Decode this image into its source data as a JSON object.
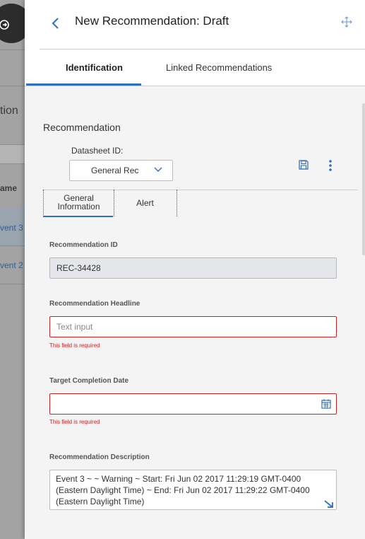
{
  "background": {
    "partial_heading": "tion",
    "column_header": "ame",
    "rows": [
      "vent 3",
      "vent 2"
    ]
  },
  "panel": {
    "title": "New Recommendation: Draft",
    "tabs": [
      {
        "label": "Identification",
        "active": true
      },
      {
        "label": "Linked Recommendations",
        "active": false
      }
    ],
    "section_title": "Recommendation",
    "datasheet": {
      "label": "Datasheet ID:",
      "value": "General Rec"
    },
    "subtabs": [
      {
        "label": "General Information",
        "active": true
      },
      {
        "label": "Alert",
        "active": false
      }
    ],
    "fields": {
      "rec_id": {
        "label": "Recommendation ID",
        "value": "REC-34428"
      },
      "headline": {
        "label": "Recommendation Headline",
        "placeholder": "Text input",
        "error": "This field is required"
      },
      "target_date": {
        "label": "Target Completion Date",
        "value": "",
        "error": "This field is required"
      },
      "description": {
        "label": "Recommendation Description",
        "value": "Event 3 ~ ~ Warning ~ Start: Fri Jun 02 2017 11:29:19 GMT-0400 (Eastern Daylight Time) ~ End: Fri Jun 02 2017 11:29:22 GMT-0400 (Eastern Daylight Time)"
      }
    }
  },
  "icons": {
    "back": "chevron-left-icon",
    "expand": "move-icon",
    "save": "save-icon",
    "more": "kebab-icon",
    "calendar": "calendar-icon",
    "resize": "resize-handle-icon",
    "sidebar_toggle": "logout-icon"
  },
  "colors": {
    "accent": "#2f6fbd",
    "error": "#cc2222",
    "readonly_bg": "#e4e6ea"
  }
}
